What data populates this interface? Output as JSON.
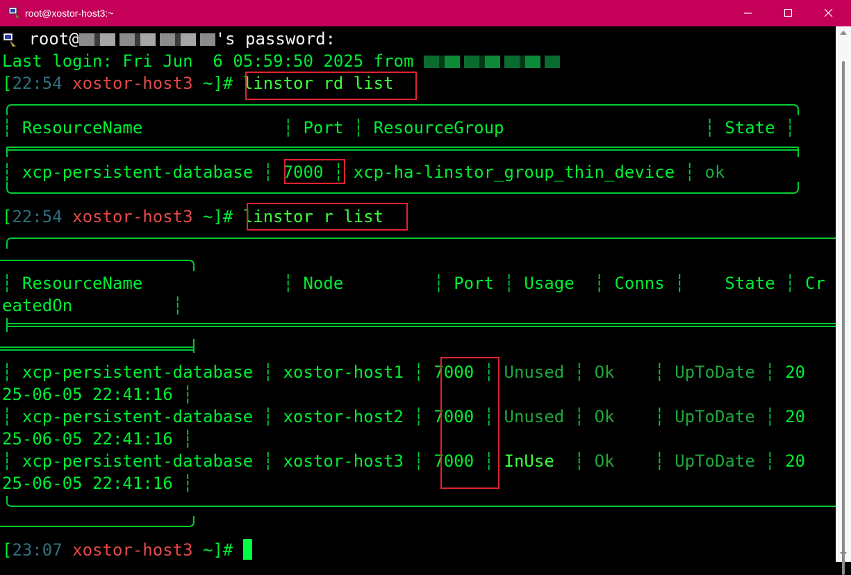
{
  "window": {
    "title": "root@xostor-host3:~",
    "buttons": {
      "minimize": "minimize",
      "maximize": "maximize",
      "close": "close"
    }
  },
  "terminal": {
    "password_prompt": {
      "user": "root@",
      "suffix": "'s password:"
    },
    "last_login": {
      "text": "Last login: Fri Jun  6 05:59:50 2025 from"
    },
    "prompt1": {
      "open": "[",
      "time": "22:54",
      "host": "xostor-host3",
      "tail": " ~]#",
      "command": "linstor rd list"
    },
    "rd_table": {
      "headers": [
        "ResourceName",
        "Port",
        "ResourceGroup",
        "State"
      ],
      "rows": [
        [
          "xcp-persistent-database",
          "7000",
          "xcp-ha-linstor_group_thin_device",
          "ok"
        ]
      ]
    },
    "prompt2": {
      "open": "[",
      "time": "22:54",
      "host": "xostor-host3",
      "tail": " ~]#",
      "command": "linstor r list"
    },
    "r_table": {
      "headers": [
        "ResourceName",
        "Node",
        "Port",
        "Usage",
        "Conns",
        "State",
        "Cr"
      ],
      "header_wrap": "eatedOn",
      "rows": [
        {
          "name": "xcp-persistent-database",
          "node": "xostor-host1",
          "port": "7000",
          "usage": "Unused",
          "conns": "Ok",
          "state": "UpToDate",
          "created_a": "20",
          "created_b": "25-06-05 22:41:16"
        },
        {
          "name": "xcp-persistent-database",
          "node": "xostor-host2",
          "port": "7000",
          "usage": "Unused",
          "conns": "Ok",
          "state": "UpToDate",
          "created_a": "20",
          "created_b": "25-06-05 22:41:16"
        },
        {
          "name": "xcp-persistent-database",
          "node": "xostor-host3",
          "port": "7000",
          "usage": "InUse",
          "conns": "Ok",
          "state": "UpToDate",
          "created_a": "20",
          "created_b": "25-06-05 22:41:16"
        }
      ]
    },
    "prompt3": {
      "open": "[",
      "time": "23:07",
      "host": "xostor-host3",
      "tail": " ~]#"
    }
  },
  "colors": {
    "titlebar": "#c40058",
    "terminal_bg": "#000000",
    "text": "#00ee33",
    "highlight_box": "#e0242f"
  }
}
